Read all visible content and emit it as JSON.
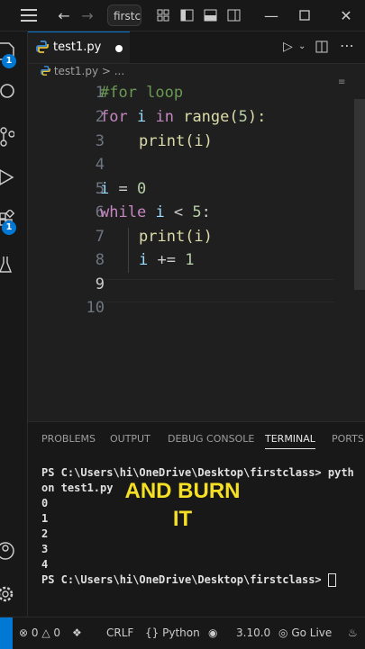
{
  "titlebar": {
    "search_text": "firstcl"
  },
  "tab": {
    "label": "test1.py"
  },
  "breadcrumb": {
    "file": "test1.py",
    "sep": "> ..."
  },
  "activity": {
    "explorer_badge": "1",
    "extensions_badge": "1"
  },
  "editor": {
    "lines": [
      {
        "n": "1"
      },
      {
        "n": "2"
      },
      {
        "n": "3"
      },
      {
        "n": "4"
      },
      {
        "n": "5"
      },
      {
        "n": "6"
      },
      {
        "n": "7"
      },
      {
        "n": "8"
      },
      {
        "n": "9"
      },
      {
        "n": "10"
      }
    ],
    "code": {
      "l1": "#for loop",
      "l2_kw": "for",
      "l2_var": "i",
      "l2_in": "in",
      "l2_fn": "range",
      "l2_open": "(",
      "l2_num": "5",
      "l2_close": "):",
      "l3_fn": "print",
      "l3_rest": "(i)",
      "l5_var": "i",
      "l5_eq": " = ",
      "l5_num": "0",
      "l6_kw": "while",
      "l6_var": "i",
      "l6_op": " < ",
      "l6_num": "5",
      "l6_colon": ":",
      "l7_fn": "print",
      "l7_rest": "(i)",
      "l8_var": "i",
      "l8_op": " += ",
      "l8_num": "1"
    }
  },
  "panel": {
    "tabs": [
      "PROBLEMS",
      "OUTPUT",
      "DEBUG CONSOLE",
      "TERMINAL",
      "PORTS"
    ],
    "terminal_lines": [
      "PS C:\\Users\\hi\\OneDrive\\Desktop\\firstclass> pyth",
      "on test1.py",
      "0",
      "1",
      "2",
      "3",
      "4",
      "PS C:\\Users\\hi\\OneDrive\\Desktop\\firstclass> "
    ]
  },
  "caption": {
    "line1": "AND BURN",
    "line2": "IT"
  },
  "status": {
    "errors": "0",
    "warnings": "0",
    "eol": "CRLF",
    "language": "Python",
    "version": "3.10.0",
    "golive": "Go Live"
  },
  "colors": {
    "accent": "#0078d4",
    "caption": "#f5e024"
  }
}
